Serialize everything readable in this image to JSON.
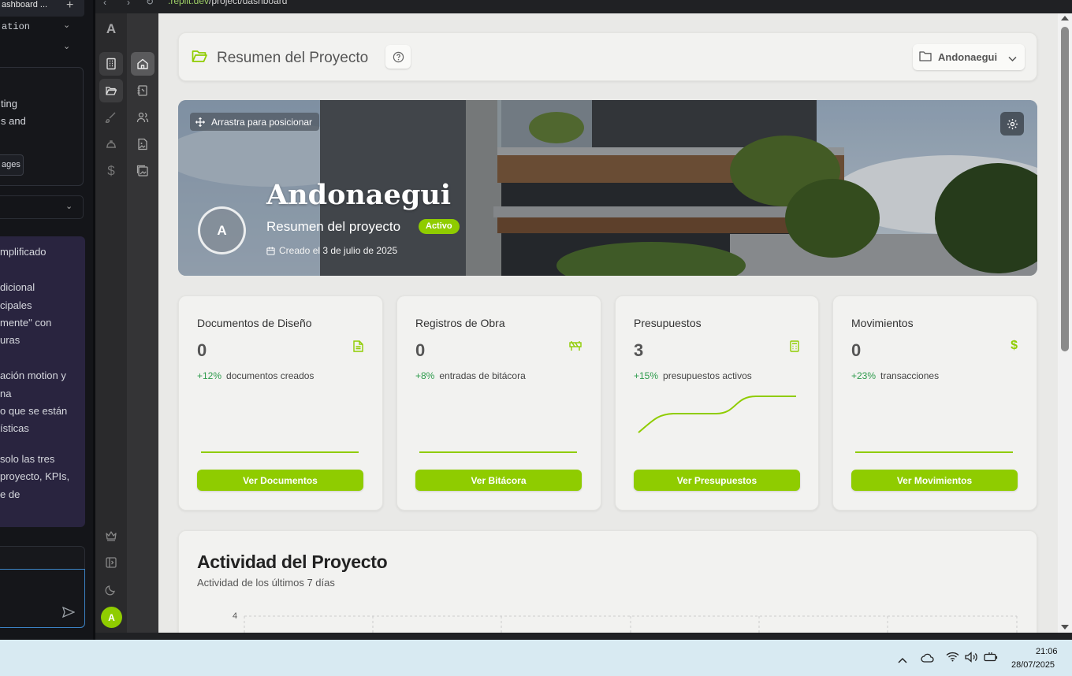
{
  "left_panel": {
    "tab_title": "ashboard ...",
    "row1": "ation",
    "snippet_a": [
      "ting",
      "s and"
    ],
    "images_button": "ages",
    "chat_lines": [
      "mplificado",
      "dicional",
      "cipales",
      "mente\" con",
      "uras",
      "ación motion y",
      "na",
      "o que se están",
      "ísticas",
      "solo las tres",
      "proyecto, KPIs,",
      "e de"
    ]
  },
  "browser": {
    "url_domain": ".replit.dev",
    "url_path": "/project/dashboard"
  },
  "sidebar": {
    "logo": "A",
    "avatar": "A"
  },
  "header": {
    "title": "Resumen del Proyecto",
    "project_selector": "Andonaegui"
  },
  "hero": {
    "drag_label": "Arrastra para posicionar",
    "avatar_letter": "A",
    "project_name": "Andonaegui",
    "subtitle": "Resumen del proyecto",
    "status": "Activo",
    "created": "Creado el 3 de julio de 2025"
  },
  "kpis": [
    {
      "title": "Documentos de Diseño",
      "value": "0",
      "pct": "+12%",
      "desc": "documentos creados",
      "button": "Ver Documentos",
      "icon": "document-icon"
    },
    {
      "title": "Registros de Obra",
      "value": "0",
      "pct": "+8%",
      "desc": "entradas de bitácora",
      "button": "Ver Bitácora",
      "icon": "construction-icon"
    },
    {
      "title": "Presupuestos",
      "value": "3",
      "pct": "+15%",
      "desc": "presupuestos activos",
      "button": "Ver Presupuestos",
      "icon": "calculator-icon"
    },
    {
      "title": "Movimientos",
      "value": "0",
      "pct": "+23%",
      "desc": "transacciones",
      "button": "Ver Movimientos",
      "icon": "dollar-icon"
    }
  ],
  "activity": {
    "title": "Actividad del Proyecto",
    "subtitle": "Actividad de los últimos 7 días",
    "y_tick_top": "4"
  },
  "taskbar": {
    "time": "21:06",
    "date": "28/07/2025"
  },
  "colors": {
    "accent": "#8fcc00",
    "positive": "#2e9b4c",
    "sidebar_dark": "#2a2a2c"
  }
}
